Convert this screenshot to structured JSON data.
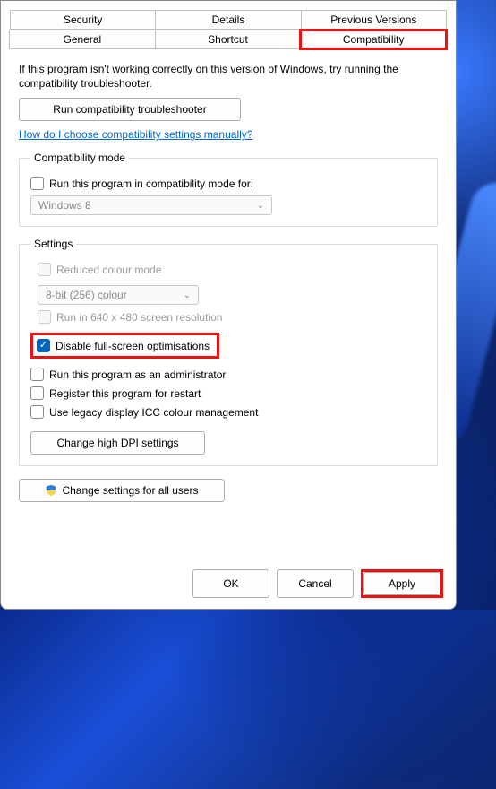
{
  "tabs": {
    "row1": [
      "Security",
      "Details",
      "Previous Versions"
    ],
    "row2": [
      "General",
      "Shortcut",
      "Compatibility"
    ],
    "active": "Compatibility"
  },
  "intro": "If this program isn't working correctly on this version of Windows, try running the compatibility troubleshooter.",
  "run_troubleshooter": "Run compatibility troubleshooter",
  "manual_link": "How do I choose compatibility settings manually?",
  "compat_mode": {
    "legend": "Compatibility mode",
    "checkbox_label": "Run this program in compatibility mode for:",
    "select_value": "Windows 8"
  },
  "settings": {
    "legend": "Settings",
    "reduced_colour": "Reduced colour mode",
    "colour_select": "8-bit (256) colour",
    "run_640": "Run in 640 x 480 screen resolution",
    "disable_fullscreen": "Disable full-screen optimisations",
    "run_admin": "Run this program as an administrator",
    "register_restart": "Register this program for restart",
    "legacy_icc": "Use legacy display ICC colour management",
    "change_dpi": "Change high DPI settings"
  },
  "change_all_users": "Change settings for all users",
  "footer": {
    "ok": "OK",
    "cancel": "Cancel",
    "apply": "Apply"
  }
}
